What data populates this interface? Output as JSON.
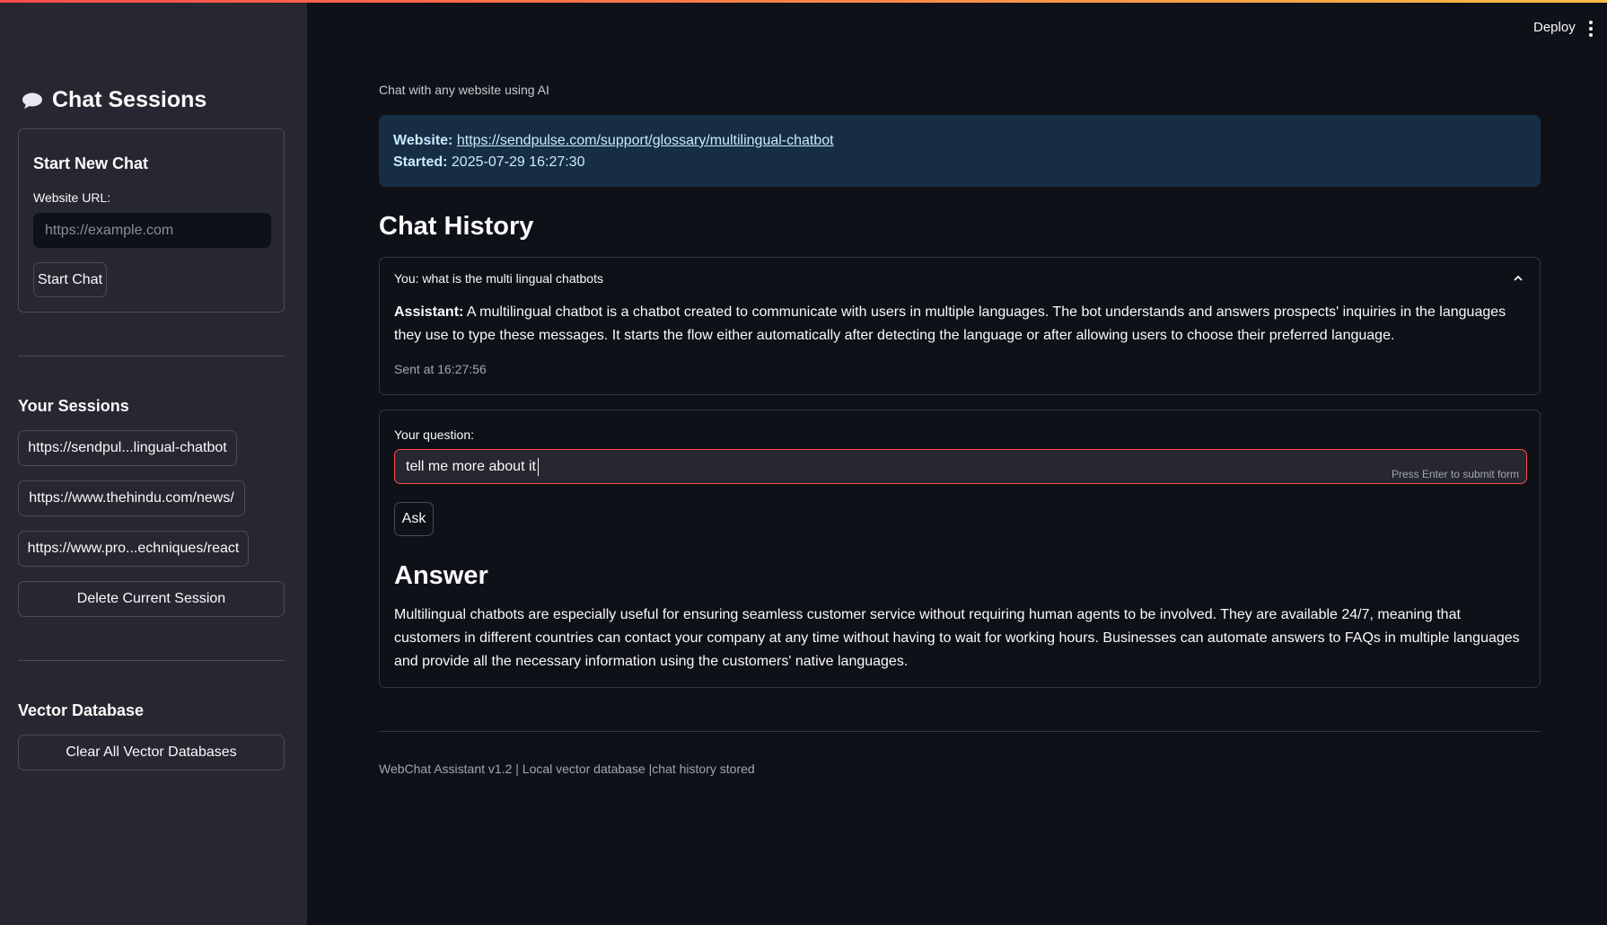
{
  "colors": {
    "accent": "#ff4b4b",
    "sidebar_bg": "#262730",
    "main_bg": "#0e1117",
    "info_bg": "#172d43",
    "info_text": "#c7ebff"
  },
  "sidebar": {
    "title_icon": "speech-bubble-icon",
    "title": "Chat Sessions",
    "new_chat": {
      "title": "Start New Chat",
      "url_label": "Website URL:",
      "url_value": "",
      "url_placeholder": "https://example.com",
      "start_button": "Start Chat"
    },
    "sessions_heading": "Your Sessions",
    "sessions": [
      "https://sendpul...lingual-chatbot",
      "https://www.thehindu.com/news/",
      "https://www.pro...echniques/react"
    ],
    "delete_button": "Delete Current Session",
    "vector_heading": "Vector Database",
    "clear_button": "Clear All Vector Databases"
  },
  "header": {
    "deploy_label": "Deploy",
    "menu_icon": "vertical-ellipsis-icon"
  },
  "main": {
    "subtitle": "Chat with any website using AI",
    "info": {
      "website_label": "Website:",
      "website_url": "https://sendpulse.com/support/glossary/multilingual-chatbot",
      "started_label": "Started:",
      "started_value": "2025-07-29 16:27:30"
    },
    "history_heading": "Chat History",
    "history": [
      {
        "question": "You: what is the multi lingual chatbots",
        "assistant_label": "Assistant:",
        "answer": "A multilingual chatbot is a chatbot created to communicate with users in multiple languages. The bot understands and answers prospects' inquiries in the languages they use to type these messages. It starts the flow either automatically after detecting the language or after allowing users to choose their preferred language.",
        "sent": "Sent at 16:27:56"
      }
    ],
    "form": {
      "question_label": "Your question:",
      "question_value": "tell me more about it",
      "enter_hint": "Press Enter to submit form",
      "ask_button": "Ask"
    },
    "answer_heading": "Answer",
    "answer_text": "Multilingual chatbots are especially useful for ensuring seamless customer service without requiring human agents to be involved. They are available 24/7, meaning that customers in different countries can contact your company at any time without having to wait for working hours. Businesses can automate answers to FAQs in multiple languages and provide all the necessary information using the customers' native languages.",
    "footer": "WebChat Assistant v1.2 | Local vector database |chat history stored"
  }
}
